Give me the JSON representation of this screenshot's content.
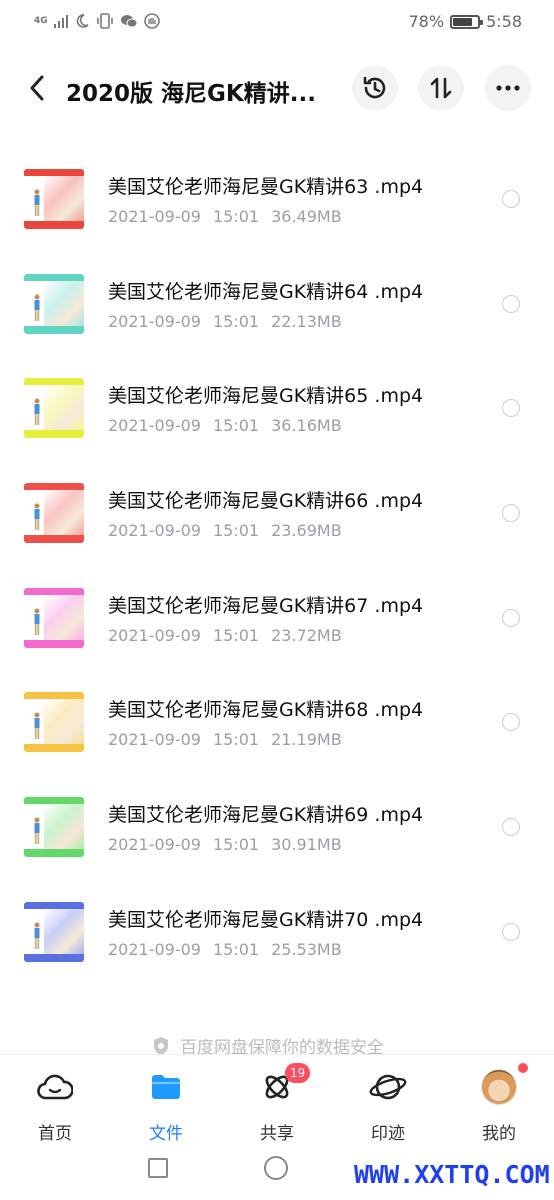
{
  "status_bar": {
    "network_label": "4G",
    "battery_percent": "78%",
    "battery_level": 0.78,
    "time": "5:58",
    "icons": [
      "signal-icon",
      "moon-icon",
      "vibrate-icon",
      "wechat-icon",
      "hand-icon"
    ]
  },
  "header": {
    "title": "2020版 海尼GK精讲...",
    "back_icon": "chevron-left-icon",
    "actions": [
      "history-icon",
      "sort-icon",
      "more-icon"
    ]
  },
  "files": [
    {
      "name": "美国艾伦老师海尼曼GK精讲63 .mp4",
      "date": "2021-09-09",
      "time": "15:01",
      "size": "36.49MB",
      "accent": "#e8463c"
    },
    {
      "name": "美国艾伦老师海尼曼GK精讲64 .mp4",
      "date": "2021-09-09",
      "time": "15:01",
      "size": "22.13MB",
      "accent": "#5fd4c0"
    },
    {
      "name": "美国艾伦老师海尼曼GK精讲65 .mp4",
      "date": "2021-09-09",
      "time": "15:01",
      "size": "36.16MB",
      "accent": "#e8ee3c"
    },
    {
      "name": "美国艾伦老师海尼曼GK精讲66 .mp4",
      "date": "2021-09-09",
      "time": "15:01",
      "size": "23.69MB",
      "accent": "#f0504a"
    },
    {
      "name": "美国艾伦老师海尼曼GK精讲67 .mp4",
      "date": "2021-09-09",
      "time": "15:01",
      "size": "23.72MB",
      "accent": "#f26ad0"
    },
    {
      "name": "美国艾伦老师海尼曼GK精讲68 .mp4",
      "date": "2021-09-09",
      "time": "15:01",
      "size": "21.19MB",
      "accent": "#f5c242"
    },
    {
      "name": "美国艾伦老师海尼曼GK精讲69 .mp4",
      "date": "2021-09-09",
      "time": "15:01",
      "size": "30.91MB",
      "accent": "#63d86a"
    },
    {
      "name": "美国艾伦老师海尼曼GK精讲70 .mp4",
      "date": "2021-09-09",
      "time": "15:01",
      "size": "25.53MB",
      "accent": "#5a6fe0"
    }
  ],
  "security_note": "百度网盘保障你的数据安全",
  "bottom_nav": {
    "home": "首页",
    "files": "文件",
    "share": "共享",
    "share_badge": "19",
    "traces": "印迹",
    "mine": "我的"
  },
  "colors": {
    "active": "#1f7eff",
    "badge": "#ff4d5e",
    "watermark": "#1f3ff0"
  },
  "watermark": "WWW.XXTTQ.COM"
}
